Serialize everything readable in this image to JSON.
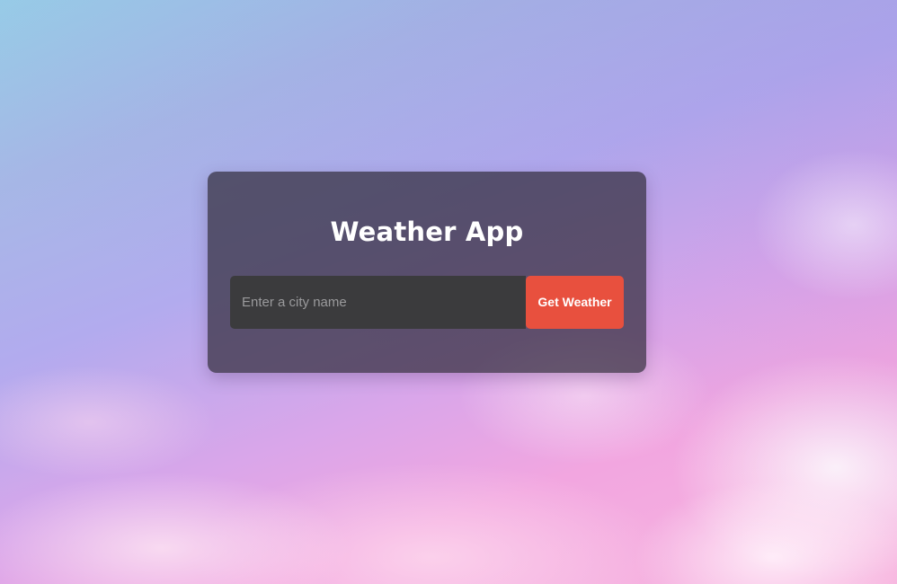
{
  "app": {
    "title": "Weather App"
  },
  "search": {
    "placeholder": "Enter a city name",
    "value": "",
    "button_label": "Get Weather"
  },
  "colors": {
    "button": "#e8503e",
    "card": "rgba(50,45,60,0.72)",
    "input": "#3b3b3d"
  }
}
